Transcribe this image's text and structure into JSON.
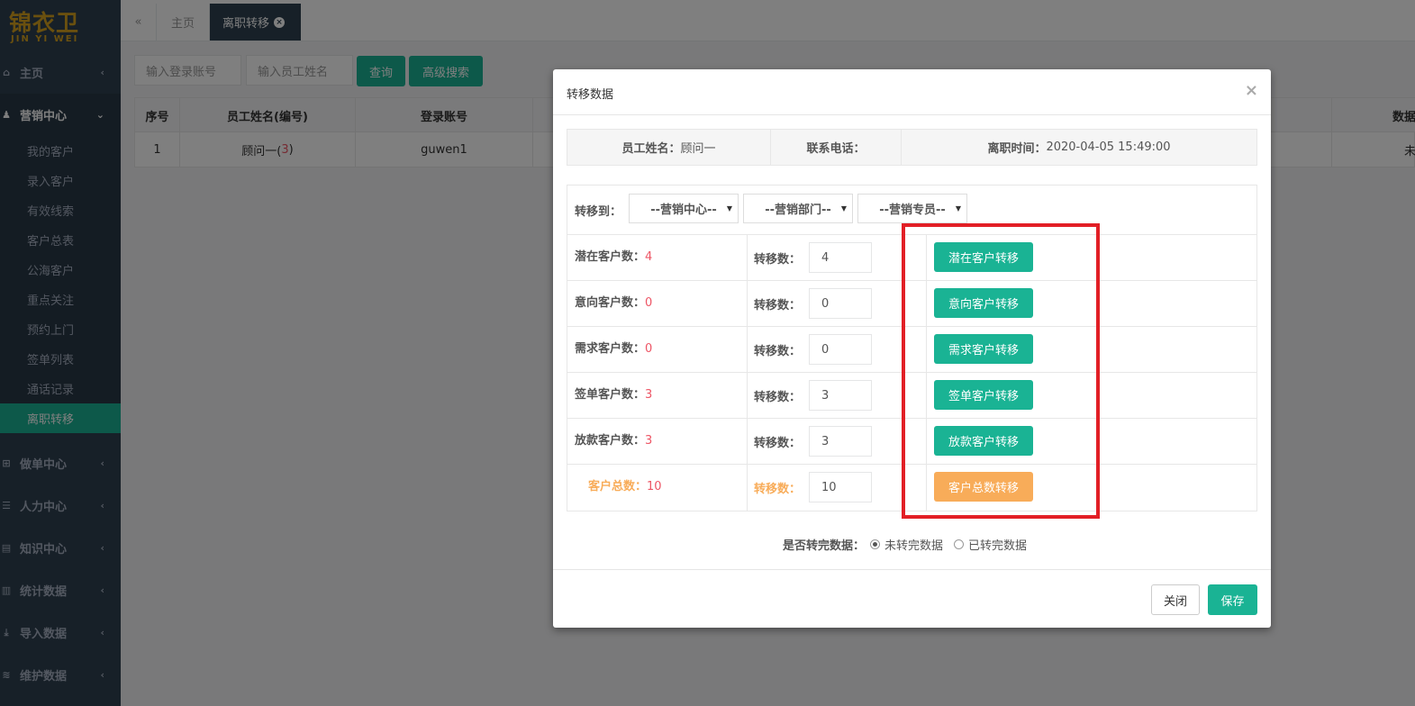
{
  "logo": {
    "cn": "锦衣卫",
    "en": "JIN YI WEI"
  },
  "sidebar": {
    "home": "主页",
    "marketing": "营销中心",
    "sub_items": [
      "我的客户",
      "录入客户",
      "有效线索",
      "客户总表",
      "公海客户",
      "重点关注",
      "预约上门",
      "签单列表",
      "通话记录",
      "离职转移"
    ],
    "groups": [
      "做单中心",
      "人力中心",
      "知识中心",
      "统计数据",
      "导入数据",
      "维护数据"
    ]
  },
  "tabs": {
    "home": "主页",
    "current": "离职转移"
  },
  "search": {
    "account_placeholder": "输入登录账号",
    "name_placeholder": "输入员工姓名",
    "query": "查询",
    "advanced": "高级搜索"
  },
  "table": {
    "headers": [
      "序号",
      "员工姓名(编号)",
      "登录账号",
      "数据"
    ],
    "row": {
      "index": "1",
      "name": "顾问一(",
      "code": "3",
      "name_end": ")",
      "account": "guwen1",
      "status": "未"
    }
  },
  "modal": {
    "title": "转移数据",
    "close_x": "×",
    "info": {
      "name_label": "员工姓名：",
      "name": "顾问一",
      "phone_label": "联系电话：",
      "leave_label": "离职时间：",
      "leave": "2020-04-05 15:49:00"
    },
    "transfer_to": "转移到：",
    "selects": [
      "--营销中心--",
      "--营销部门--",
      "--营销专员--"
    ],
    "count_label": "转移数：",
    "rows": [
      {
        "label": "潜在客户数：",
        "value": "4",
        "input": "4",
        "button": "潜在客户转移"
      },
      {
        "label": "意向客户数：",
        "value": "0",
        "input": "0",
        "button": "意向客户转移"
      },
      {
        "label": "需求客户数：",
        "value": "0",
        "input": "0",
        "button": "需求客户转移"
      },
      {
        "label": "签单客户数：",
        "value": "3",
        "input": "3",
        "button": "签单客户转移"
      },
      {
        "label": "放款客户数：",
        "value": "3",
        "input": "3",
        "button": "放款客户转移"
      }
    ],
    "total": {
      "label": "客户总数：",
      "value": "10",
      "input": "10",
      "button": "客户总数转移"
    },
    "complete_label": "是否转完数据：",
    "opt_no": "未转完数据",
    "opt_yes": "已转完数据",
    "close_btn": "关闭",
    "save_btn": "保存"
  },
  "colors": {
    "sidebar": "#2f4050",
    "primary": "#1ab394",
    "warning": "#f8ac59",
    "danger": "#ed5565",
    "highlight": "#e21f26"
  }
}
